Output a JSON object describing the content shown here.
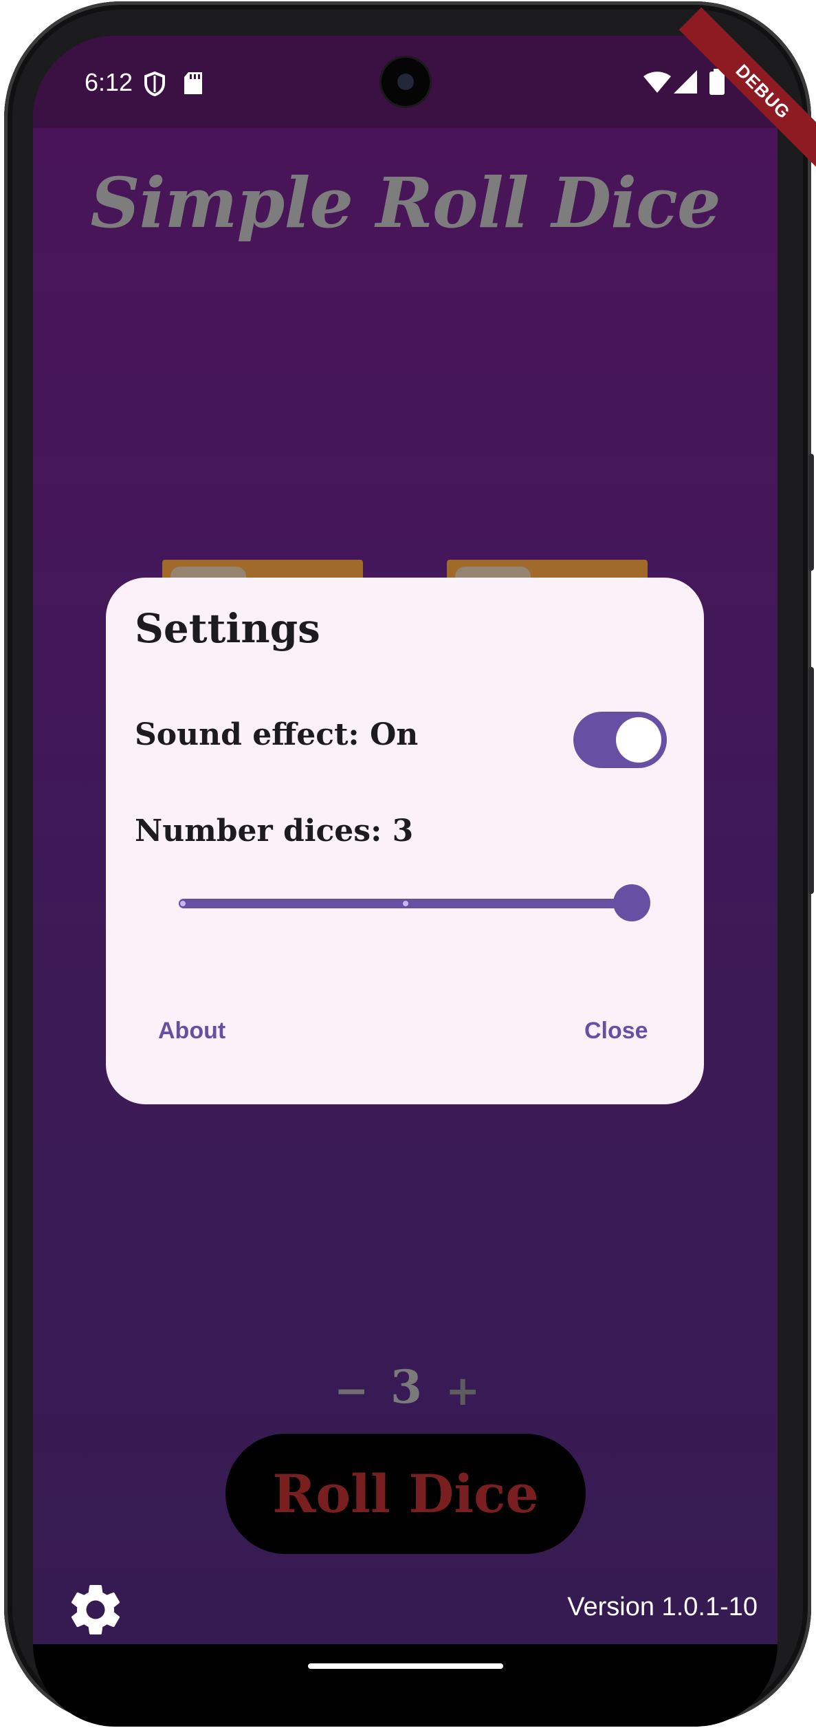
{
  "status_bar": {
    "time": "6:12",
    "icons": [
      "shield-icon",
      "sd-card-icon",
      "wifi-icon",
      "signal-icon",
      "battery-icon"
    ]
  },
  "debug_banner": "DEBUG",
  "app": {
    "title": "Simple Roll Dice",
    "dice_count_display": "3",
    "minus_symbol": "−",
    "plus_symbol": "+",
    "roll_button_label": "Roll Dice",
    "version": "Version 1.0.1-10"
  },
  "dialog": {
    "title": "Settings",
    "sound_effect_label": "Sound effect: On",
    "sound_effect_enabled": true,
    "dice_count_label": "Number dices: 3",
    "dice_count_slider": {
      "value": 3,
      "min": 1,
      "max": 3
    },
    "about_button": "About",
    "close_button": "Close"
  },
  "colors": {
    "accent": "#6750a4",
    "dialog_background": "#fbf2f9",
    "app_background_top": "#4a1458",
    "app_background_bottom": "#361b52",
    "roll_label": "#7a1f1f",
    "title_text": "#7d7d7d"
  }
}
